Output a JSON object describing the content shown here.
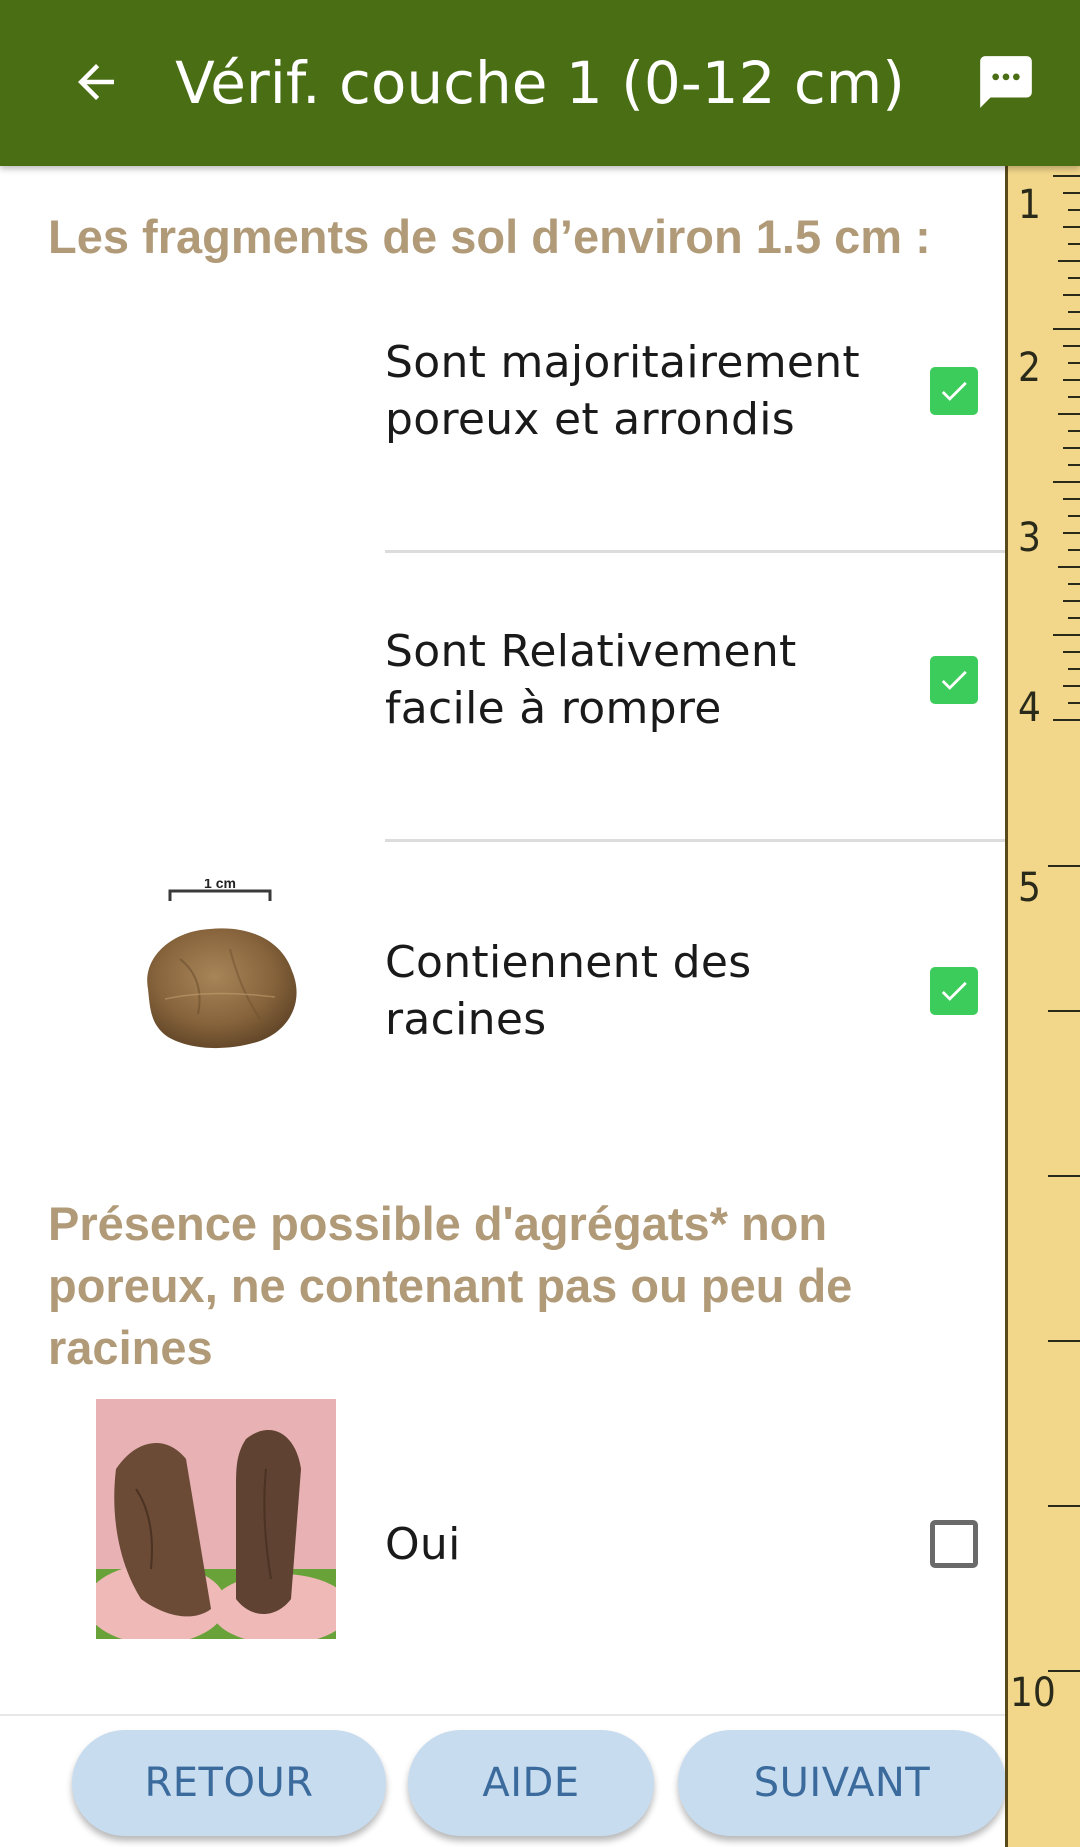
{
  "appbar": {
    "title": "Vérif. couche 1 (0-12 cm)",
    "back_icon": "arrow-left-icon",
    "chat_icon": "message-icon",
    "background_color": "#4a6e14"
  },
  "section1": {
    "title": "Les fragments de sol d’environ 1.5 cm :",
    "options": [
      {
        "label": "Sont majoritairement poreux et arrondis",
        "checked": true
      },
      {
        "label": "Sont Relativement facile à rompre",
        "checked": true
      },
      {
        "label": "Contiennent des racines",
        "checked": true
      }
    ],
    "scale_label": "1 cm"
  },
  "section2": {
    "title": "Présence possible d'agrégats* non poreux, ne contenant pas ou peu de racines",
    "options": [
      {
        "label": "Oui",
        "checked": false
      }
    ]
  },
  "ruler": {
    "labels": [
      "1",
      "2",
      "3",
      "4",
      "5",
      "10"
    ]
  },
  "buttons": {
    "back": "RETOUR",
    "help": "AIDE",
    "next": "SUIVANT"
  },
  "colors": {
    "section_title": "#b09a78",
    "checkbox_checked": "#3ccc5b",
    "button_bg": "#c8dcef",
    "button_text": "#3b6a9c",
    "ruler_bg": "#f2d68a"
  }
}
